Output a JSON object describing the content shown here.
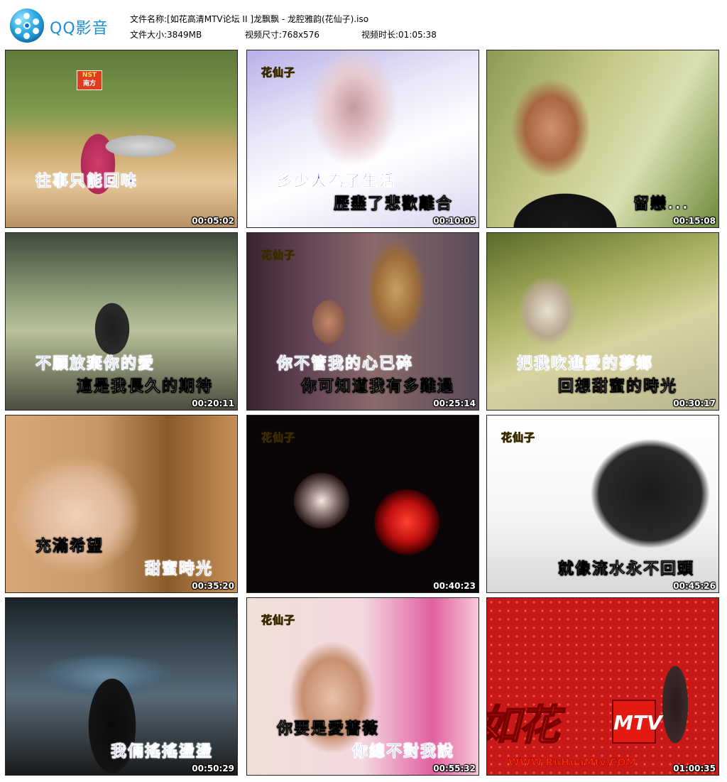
{
  "app": {
    "name": "QQ影音",
    "logo_icon": "film-reel-icon"
  },
  "info": {
    "filename_label": "文件名称:",
    "filename": "[如花高清MTV论坛 II ]龙飘飘 - 龙腔雅韵(花仙子).iso",
    "filesize_label": "文件大小:",
    "filesize": "3849MB",
    "dimensions_label": "视频尺寸:",
    "dimensions": "768x576",
    "duration_label": "视频时长:",
    "duration": "01:05:38"
  },
  "thumbnails": [
    {
      "time": "00:05:02",
      "lyrics": [
        "往事只能回味"
      ],
      "watermark": "",
      "logo": "NST 南方"
    },
    {
      "time": "00:10:05",
      "lyrics": [
        "多少人為了生活",
        "歷盡了悲歡離合"
      ],
      "watermark": "花仙子"
    },
    {
      "time": "00:15:08",
      "lyrics": [
        "留戀..."
      ],
      "watermark": ""
    },
    {
      "time": "00:20:11",
      "lyrics": [
        "不願放棄你的愛",
        "這是我長久的期待"
      ],
      "watermark": ""
    },
    {
      "time": "00:25:14",
      "lyrics": [
        "你不管我的心已碎",
        "你可知道我有多難過"
      ],
      "watermark": "花仙子"
    },
    {
      "time": "00:30:17",
      "lyrics": [
        "把我吹進愛的夢鄉",
        "回想甜蜜的時光"
      ],
      "watermark": ""
    },
    {
      "time": "00:35:20",
      "lyrics": [
        "充滿希望",
        "甜蜜時光"
      ],
      "watermark": ""
    },
    {
      "time": "00:40:23",
      "lyrics": [],
      "watermark": "花仙子"
    },
    {
      "time": "00:45:26",
      "lyrics": [
        "就像流水永不回頭"
      ],
      "watermark": "花仙子"
    },
    {
      "time": "00:50:29",
      "lyrics": [
        "我倆搖搖盪盪"
      ],
      "watermark": ""
    },
    {
      "time": "00:55:32",
      "lyrics": [
        "你要是愛薔薇",
        "你總不對我說"
      ],
      "watermark": "花仙子"
    },
    {
      "time": "01:00:35",
      "lyrics": [],
      "watermark": ""
    }
  ],
  "site_logo": {
    "text": "如花",
    "mtv": "MTV",
    "url": "WWW.RuHuaMtv.COM"
  },
  "colors": {
    "logo_blue": "#1a8fd6",
    "lyric_blue": "#1c3ad8",
    "site_red": "#ff2a0a"
  }
}
